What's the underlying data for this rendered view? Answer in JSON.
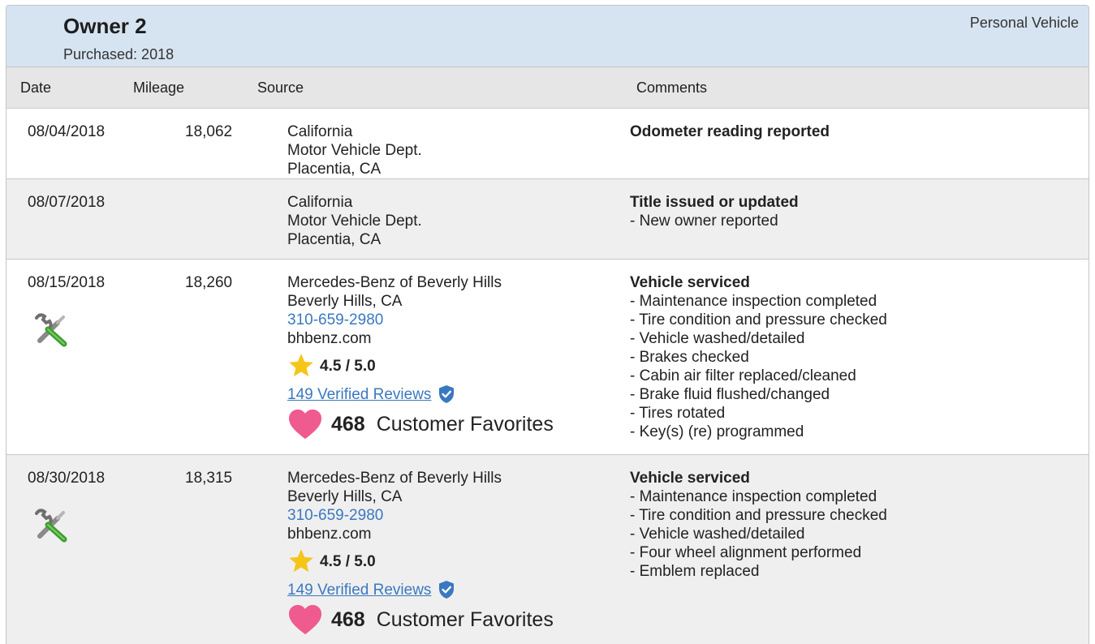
{
  "owner": {
    "title": "Owner 2",
    "purchased": "Purchased: 2018",
    "type": "Personal Vehicle"
  },
  "columns": {
    "date": "Date",
    "mileage": "Mileage",
    "source": "Source",
    "comments": "Comments"
  },
  "rows": [
    {
      "date": "08/04/2018",
      "mileage": "18,062",
      "source": [
        "California",
        "Motor Vehicle Dept.",
        "Placentia, CA"
      ],
      "comment_title": "Odometer reading reported",
      "comment_items": []
    },
    {
      "date": "08/07/2018",
      "mileage": "",
      "source": [
        "California",
        "Motor Vehicle Dept.",
        "Placentia, CA"
      ],
      "comment_title": "Title issued or updated",
      "comment_items": [
        "- New owner reported"
      ]
    },
    {
      "date": "08/15/2018",
      "mileage": "18,260",
      "icon": "service-tools-icon",
      "source": [
        "Mercedes-Benz of Beverly Hills",
        "Beverly Hills, CA"
      ],
      "phone": "310-659-2980",
      "website": "bhbenz.com",
      "rating": "4.5 / 5.0",
      "reviews": "149 Verified Reviews",
      "favorites_count": "468",
      "favorites_label": "Customer Favorites",
      "comment_title": "Vehicle serviced",
      "comment_items": [
        "- Maintenance inspection completed",
        "- Tire condition and pressure checked",
        "- Vehicle washed/detailed",
        "- Brakes checked",
        "- Cabin air filter replaced/cleaned",
        "- Brake fluid flushed/changed",
        "- Tires rotated",
        "- Key(s) (re) programmed"
      ]
    },
    {
      "date": "08/30/2018",
      "mileage": "18,315",
      "icon": "service-tools-icon",
      "source": [
        "Mercedes-Benz of Beverly Hills",
        "Beverly Hills, CA"
      ],
      "phone": "310-659-2980",
      "website": "bhbenz.com",
      "rating": "4.5 / 5.0",
      "reviews": "149 Verified Reviews",
      "favorites_count": "468",
      "favorites_label": "Customer Favorites",
      "comment_title": "Vehicle serviced",
      "comment_items": [
        "- Maintenance inspection completed",
        "- Tire condition and pressure checked",
        "- Vehicle washed/detailed",
        "- Four wheel alignment performed",
        "- Emblem replaced"
      ]
    }
  ],
  "colors": {
    "header_bg": "#d6e4f2",
    "link": "#3a78c0",
    "star": "#f5c518",
    "heart": "#ef5a8f",
    "shield": "#3a78c0"
  }
}
